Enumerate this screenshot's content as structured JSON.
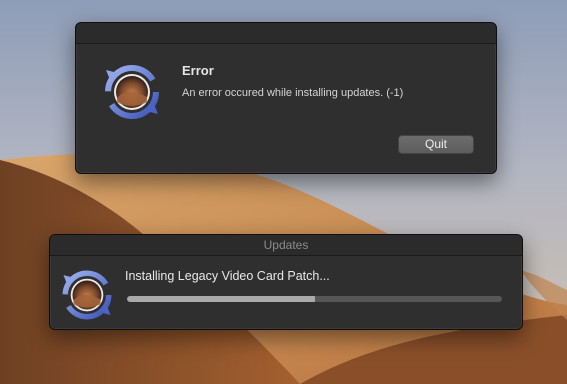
{
  "error_dialog": {
    "title": "Error",
    "message": "An error occured while installing updates. (-1)",
    "quit_label": "Quit",
    "icon": "software-update-icon"
  },
  "updates_window": {
    "title": "Updates",
    "status": "Installing Legacy Video Card Patch...",
    "progress": 0.5,
    "icon": "software-update-icon"
  },
  "colors": {
    "window_bg": "#2f2f2f",
    "button_bg": "#626262",
    "progress_fill": "#a9a9a9",
    "progress_track": "#565656"
  }
}
